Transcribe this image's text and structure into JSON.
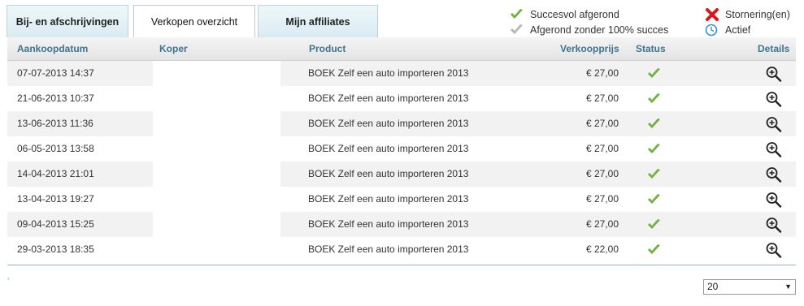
{
  "tabs": [
    {
      "label": "Bij- en afschrijvingen"
    },
    {
      "label": "Verkopen overzicht"
    },
    {
      "label": "Mijn affiliates"
    }
  ],
  "legend": {
    "success": "Succesvol afgerond",
    "partial": "Afgerond zonder 100% succes",
    "error": "Stornering(en)",
    "active": "Actief"
  },
  "colors": {
    "header_text": "#3f7491",
    "check_green": "#6db33f",
    "check_grey": "#b5b5b5",
    "error_red": "#d9161b",
    "clock_blue": "#3a8fd1"
  },
  "table": {
    "headers": {
      "date": "Aankoopdatum",
      "koper": "Koper",
      "product": "Product",
      "price": "Verkoopprijs",
      "status": "Status",
      "details": "Details"
    },
    "rows": [
      {
        "date": "07-07-2013 14:37",
        "product": "BOEK Zelf een auto importeren 2013",
        "price": "€ 27,00",
        "status": "check-icon"
      },
      {
        "date": "21-06-2013 10:37",
        "product": "BOEK Zelf een auto importeren 2013",
        "price": "€ 27,00",
        "status": "check-icon"
      },
      {
        "date": "13-06-2013 11:36",
        "product": "BOEK Zelf een auto importeren 2013",
        "price": "€ 27,00",
        "status": "check-icon"
      },
      {
        "date": "06-05-2013 13:58",
        "product": "BOEK Zelf een auto importeren 2013",
        "price": "€ 27,00",
        "status": "check-icon"
      },
      {
        "date": "14-04-2013 21:01",
        "product": "BOEK Zelf een auto importeren 2013",
        "price": "€ 27,00",
        "status": "check-icon"
      },
      {
        "date": "13-04-2013 19:27",
        "product": "BOEK Zelf een auto importeren 2013",
        "price": "€ 27,00",
        "status": "check-icon"
      },
      {
        "date": "09-04-2013 15:25",
        "product": "BOEK Zelf een auto importeren 2013",
        "price": "€ 27,00",
        "status": "check-icon"
      },
      {
        "date": "29-03-2013 18:35",
        "product": "BOEK Zelf een auto importeren 2013",
        "price": "€ 22,00",
        "status": "check-icon"
      }
    ]
  },
  "pagination": {
    "per_page": "20"
  }
}
